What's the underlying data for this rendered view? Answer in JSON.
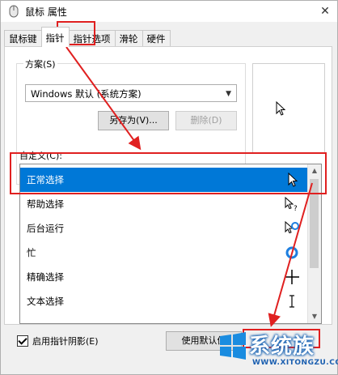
{
  "window": {
    "title": "鼠标 属性",
    "close_symbol": "✕"
  },
  "tabs": [
    {
      "label": "鼠标键",
      "active": false
    },
    {
      "label": "指针",
      "active": true
    },
    {
      "label": "指针选项",
      "active": false
    },
    {
      "label": "滑轮",
      "active": false
    },
    {
      "label": "硬件",
      "active": false
    }
  ],
  "scheme": {
    "label": "方案(S)",
    "selected": "Windows 默认 (系统方案)",
    "save_as_label": "另存为(V)...",
    "delete_label": "删除(D)"
  },
  "customize": {
    "label": "自定义(C):",
    "rows": [
      {
        "label": "正常选择",
        "icon": "arrow-cursor-icon",
        "selected": true
      },
      {
        "label": "帮助选择",
        "icon": "help-cursor-icon",
        "selected": false
      },
      {
        "label": "后台运行",
        "icon": "working-cursor-icon",
        "selected": false
      },
      {
        "label": "忙",
        "icon": "busy-cursor-icon",
        "selected": false
      },
      {
        "label": "精确选择",
        "icon": "crosshair-cursor-icon",
        "selected": false
      },
      {
        "label": "文本选择",
        "icon": "text-cursor-icon",
        "selected": false
      }
    ]
  },
  "shadow": {
    "label": "启用指针阴影(E)",
    "checked": true
  },
  "use_default_label": "使用默认值",
  "colors": {
    "accent": "#0078d7",
    "annotation": "#e02020"
  },
  "watermark": {
    "text": "系统族",
    "url": "WWW.XITONGZU.COM"
  }
}
